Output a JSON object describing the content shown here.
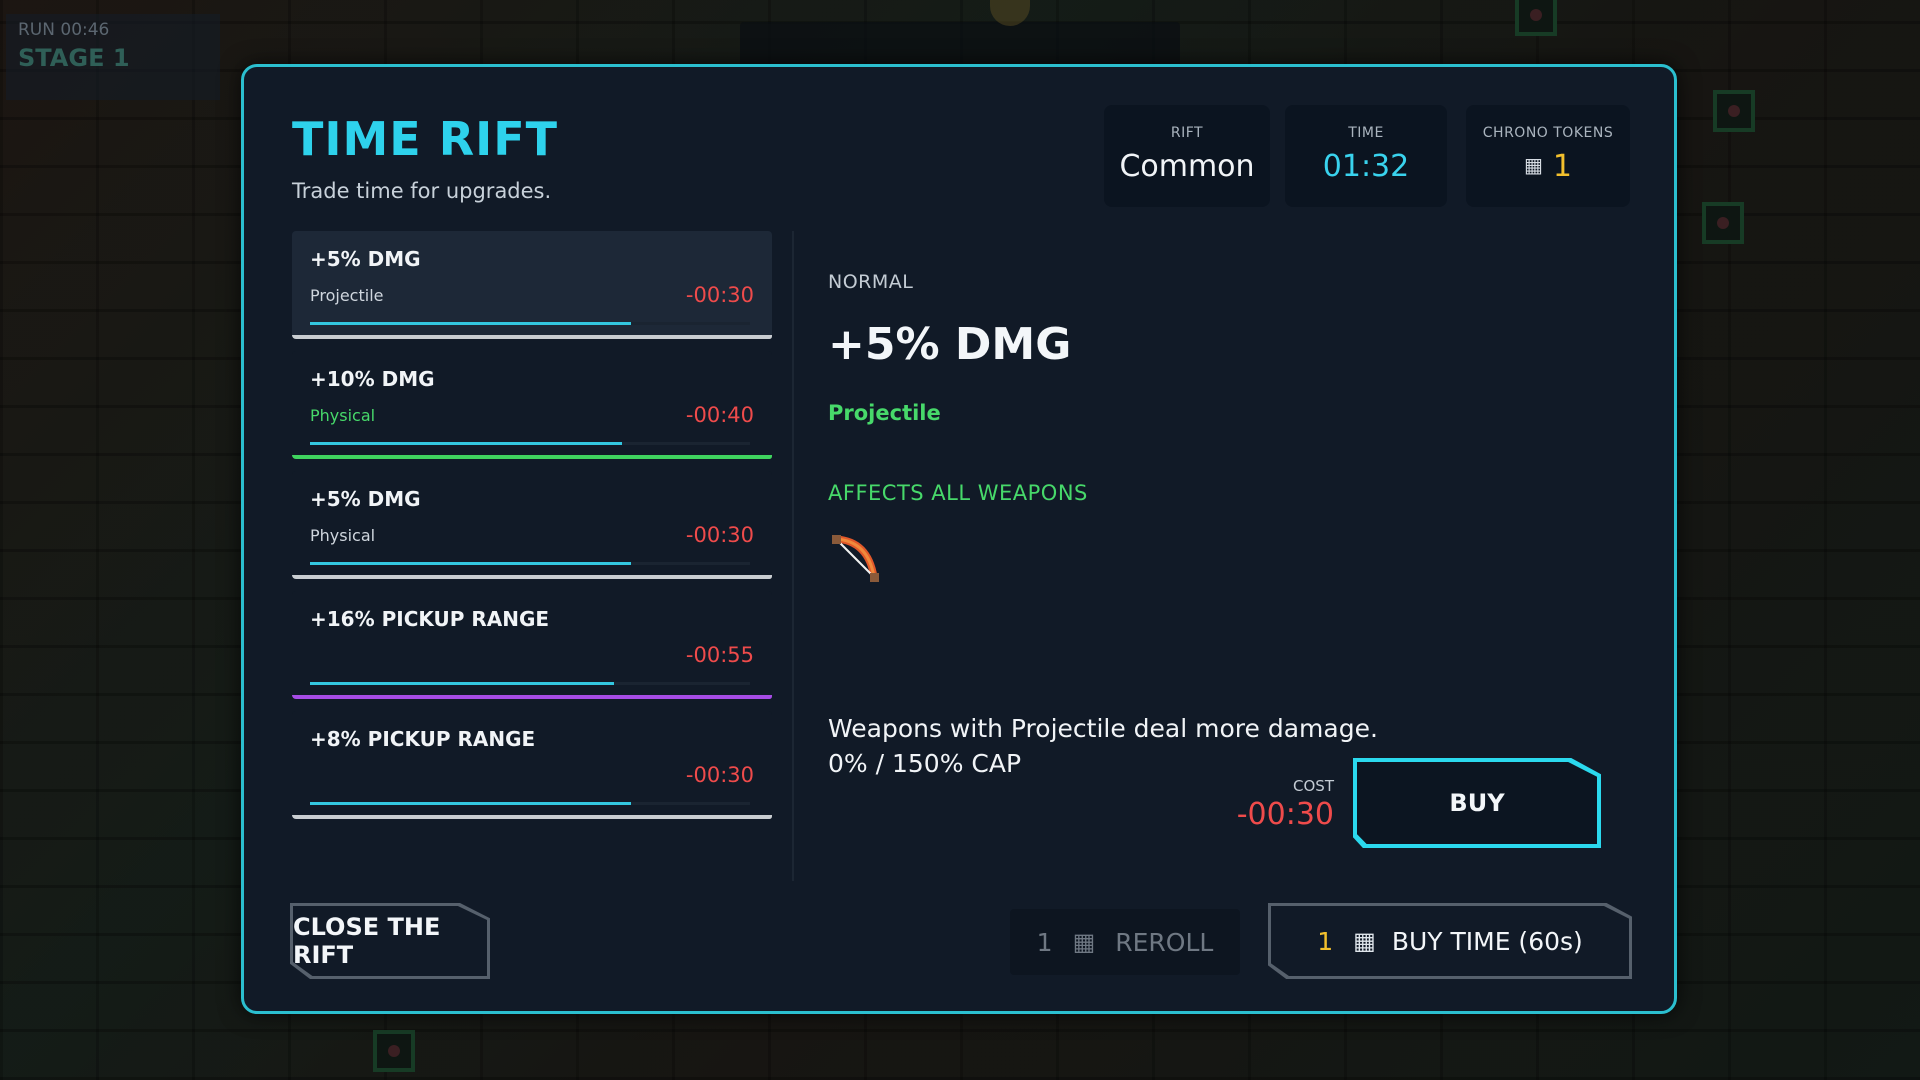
{
  "hud": {
    "run": "RUN 00:46",
    "stage": "STAGE 1"
  },
  "rift": {
    "title": "TIME RIFT",
    "subtitle": "Trade time for upgrades."
  },
  "stats": [
    {
      "label": "RIFT",
      "value": "Common"
    },
    {
      "label": "TIME",
      "value": "01:32"
    },
    {
      "label": "CHRONO TOKENS",
      "value": "1",
      "icon": "chip-icon"
    }
  ],
  "upgrades": [
    {
      "name": "+5% DMG",
      "tag": "Projectile",
      "time": "-00:30",
      "progress": 0.73,
      "accent": "#c9cdd1",
      "selected": true
    },
    {
      "name": "+10% DMG",
      "tag": "Physical",
      "time": "-00:40",
      "progress": 0.71,
      "accent": "#3fd45f",
      "selected": false
    },
    {
      "name": "+5% DMG",
      "tag": "Physical",
      "time": "-00:30",
      "progress": 0.73,
      "accent": "#c9cdd1",
      "selected": false
    },
    {
      "name": "+16% PICKUP RANGE",
      "tag": "",
      "time": "-00:55",
      "progress": 0.69,
      "accent": "#a64ce6",
      "selected": false
    },
    {
      "name": "+8% PICKUP RANGE",
      "tag": "",
      "time": "-00:30",
      "progress": 0.73,
      "accent": "#c9cdd1",
      "selected": false
    }
  ],
  "detail": {
    "rarity": "NORMAL",
    "name": "+5% DMG",
    "tag": "Projectile",
    "affects": "AFFECTS ALL WEAPONS",
    "weapon_icon": "bow-icon",
    "description": "Weapons with Projectile deal more damage.",
    "cap": "0% / 150% CAP",
    "cost_label": "COST",
    "cost": "-00:30"
  },
  "buttons": {
    "buy": "BUY",
    "close": "CLOSE THE RIFT",
    "reroll_count": "1",
    "reroll": "REROLL",
    "buy_time_count": "1",
    "buy_time": "BUY TIME (60s)"
  },
  "colors": {
    "accent": "#2bbfcf",
    "time_cost": "#ef4b4b",
    "tag_green": "#47d96a",
    "token_gold": "#f3c02d"
  }
}
